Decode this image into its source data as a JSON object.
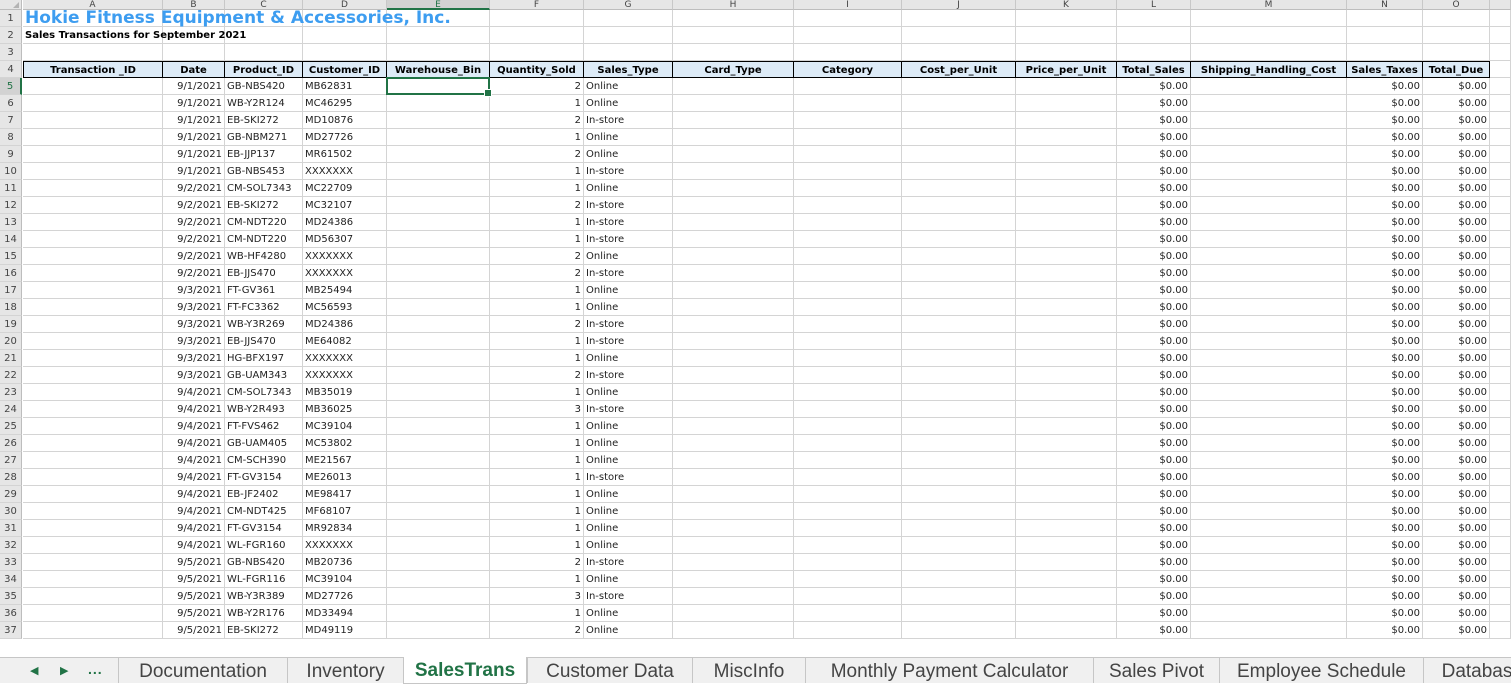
{
  "sheet": {
    "columns": [
      "A",
      "B",
      "C",
      "D",
      "E",
      "F",
      "G",
      "H",
      "I",
      "J",
      "K",
      "L",
      "M",
      "N",
      "O"
    ],
    "selected_column": "E",
    "selected_row": 5,
    "title": "Hokie Fitness Equipment & Accessories, Inc.",
    "subtitle": "Sales Transactions for September 2021",
    "headers": [
      "Transaction _ID",
      "Date",
      "Product_ID",
      "Customer_ID",
      "Warehouse_Bin",
      "Quantity_Sold",
      "Sales_Type",
      "Card_Type",
      "Category",
      "Cost_per_Unit",
      "Price_per_Unit",
      "Total_Sales",
      "Shipping_Handling_Cost",
      "Sales_Taxes",
      "Total_Due"
    ],
    "rows": [
      {
        "row": 5,
        "date": "9/1/2021",
        "product": "GB-NBS420",
        "customer": "MB62831",
        "qty": "2",
        "type": "Online",
        "total_sales": "$0.00",
        "taxes": "$0.00",
        "total_due": "$0.00"
      },
      {
        "row": 6,
        "date": "9/1/2021",
        "product": "WB-Y2R124",
        "customer": "MC46295",
        "qty": "1",
        "type": "Online",
        "total_sales": "$0.00",
        "taxes": "$0.00",
        "total_due": "$0.00"
      },
      {
        "row": 7,
        "date": "9/1/2021",
        "product": "EB-SKI272",
        "customer": "MD10876",
        "qty": "2",
        "type": "In-store",
        "total_sales": "$0.00",
        "taxes": "$0.00",
        "total_due": "$0.00"
      },
      {
        "row": 8,
        "date": "9/1/2021",
        "product": "GB-NBM271",
        "customer": "MD27726",
        "qty": "1",
        "type": "Online",
        "total_sales": "$0.00",
        "taxes": "$0.00",
        "total_due": "$0.00"
      },
      {
        "row": 9,
        "date": "9/1/2021",
        "product": "EB-JJP137",
        "customer": "MR61502",
        "qty": "2",
        "type": "Online",
        "total_sales": "$0.00",
        "taxes": "$0.00",
        "total_due": "$0.00"
      },
      {
        "row": 10,
        "date": "9/1/2021",
        "product": "GB-NBS453",
        "customer": "XXXXXXX",
        "qty": "1",
        "type": "In-store",
        "total_sales": "$0.00",
        "taxes": "$0.00",
        "total_due": "$0.00"
      },
      {
        "row": 11,
        "date": "9/2/2021",
        "product": "CM-SOL7343",
        "customer": "MC22709",
        "qty": "1",
        "type": "Online",
        "total_sales": "$0.00",
        "taxes": "$0.00",
        "total_due": "$0.00"
      },
      {
        "row": 12,
        "date": "9/2/2021",
        "product": "EB-SKI272",
        "customer": "MC32107",
        "qty": "2",
        "type": "In-store",
        "total_sales": "$0.00",
        "taxes": "$0.00",
        "total_due": "$0.00"
      },
      {
        "row": 13,
        "date": "9/2/2021",
        "product": "CM-NDT220",
        "customer": "MD24386",
        "qty": "1",
        "type": "In-store",
        "total_sales": "$0.00",
        "taxes": "$0.00",
        "total_due": "$0.00"
      },
      {
        "row": 14,
        "date": "9/2/2021",
        "product": "CM-NDT220",
        "customer": "MD56307",
        "qty": "1",
        "type": "In-store",
        "total_sales": "$0.00",
        "taxes": "$0.00",
        "total_due": "$0.00"
      },
      {
        "row": 15,
        "date": "9/2/2021",
        "product": "WB-HF4280",
        "customer": "XXXXXXX",
        "qty": "2",
        "type": "Online",
        "total_sales": "$0.00",
        "taxes": "$0.00",
        "total_due": "$0.00"
      },
      {
        "row": 16,
        "date": "9/2/2021",
        "product": "EB-JJS470",
        "customer": "XXXXXXX",
        "qty": "2",
        "type": "In-store",
        "total_sales": "$0.00",
        "taxes": "$0.00",
        "total_due": "$0.00"
      },
      {
        "row": 17,
        "date": "9/3/2021",
        "product": "FT-GV361",
        "customer": "MB25494",
        "qty": "1",
        "type": "Online",
        "total_sales": "$0.00",
        "taxes": "$0.00",
        "total_due": "$0.00"
      },
      {
        "row": 18,
        "date": "9/3/2021",
        "product": "FT-FC3362",
        "customer": "MC56593",
        "qty": "1",
        "type": "Online",
        "total_sales": "$0.00",
        "taxes": "$0.00",
        "total_due": "$0.00"
      },
      {
        "row": 19,
        "date": "9/3/2021",
        "product": "WB-Y3R269",
        "customer": "MD24386",
        "qty": "2",
        "type": "In-store",
        "total_sales": "$0.00",
        "taxes": "$0.00",
        "total_due": "$0.00"
      },
      {
        "row": 20,
        "date": "9/3/2021",
        "product": "EB-JJS470",
        "customer": "ME64082",
        "qty": "1",
        "type": "In-store",
        "total_sales": "$0.00",
        "taxes": "$0.00",
        "total_due": "$0.00"
      },
      {
        "row": 21,
        "date": "9/3/2021",
        "product": "HG-BFX197",
        "customer": "XXXXXXX",
        "qty": "1",
        "type": "Online",
        "total_sales": "$0.00",
        "taxes": "$0.00",
        "total_due": "$0.00"
      },
      {
        "row": 22,
        "date": "9/3/2021",
        "product": "GB-UAM343",
        "customer": "XXXXXXX",
        "qty": "2",
        "type": "In-store",
        "total_sales": "$0.00",
        "taxes": "$0.00",
        "total_due": "$0.00"
      },
      {
        "row": 23,
        "date": "9/4/2021",
        "product": "CM-SOL7343",
        "customer": "MB35019",
        "qty": "1",
        "type": "Online",
        "total_sales": "$0.00",
        "taxes": "$0.00",
        "total_due": "$0.00"
      },
      {
        "row": 24,
        "date": "9/4/2021",
        "product": "WB-Y2R493",
        "customer": "MB36025",
        "qty": "3",
        "type": "In-store",
        "total_sales": "$0.00",
        "taxes": "$0.00",
        "total_due": "$0.00"
      },
      {
        "row": 25,
        "date": "9/4/2021",
        "product": "FT-FVS462",
        "customer": "MC39104",
        "qty": "1",
        "type": "Online",
        "total_sales": "$0.00",
        "taxes": "$0.00",
        "total_due": "$0.00"
      },
      {
        "row": 26,
        "date": "9/4/2021",
        "product": "GB-UAM405",
        "customer": "MC53802",
        "qty": "1",
        "type": "Online",
        "total_sales": "$0.00",
        "taxes": "$0.00",
        "total_due": "$0.00"
      },
      {
        "row": 27,
        "date": "9/4/2021",
        "product": "CM-SCH390",
        "customer": "ME21567",
        "qty": "1",
        "type": "Online",
        "total_sales": "$0.00",
        "taxes": "$0.00",
        "total_due": "$0.00"
      },
      {
        "row": 28,
        "date": "9/4/2021",
        "product": "FT-GV3154",
        "customer": "ME26013",
        "qty": "1",
        "type": "In-store",
        "total_sales": "$0.00",
        "taxes": "$0.00",
        "total_due": "$0.00"
      },
      {
        "row": 29,
        "date": "9/4/2021",
        "product": "EB-JF2402",
        "customer": "ME98417",
        "qty": "1",
        "type": "Online",
        "total_sales": "$0.00",
        "taxes": "$0.00",
        "total_due": "$0.00"
      },
      {
        "row": 30,
        "date": "9/4/2021",
        "product": "CM-NDT425",
        "customer": "MF68107",
        "qty": "1",
        "type": "Online",
        "total_sales": "$0.00",
        "taxes": "$0.00",
        "total_due": "$0.00"
      },
      {
        "row": 31,
        "date": "9/4/2021",
        "product": "FT-GV3154",
        "customer": "MR92834",
        "qty": "1",
        "type": "Online",
        "total_sales": "$0.00",
        "taxes": "$0.00",
        "total_due": "$0.00"
      },
      {
        "row": 32,
        "date": "9/4/2021",
        "product": "WL-FGR160",
        "customer": "XXXXXXX",
        "qty": "1",
        "type": "Online",
        "total_sales": "$0.00",
        "taxes": "$0.00",
        "total_due": "$0.00"
      },
      {
        "row": 33,
        "date": "9/5/2021",
        "product": "GB-NBS420",
        "customer": "MB20736",
        "qty": "2",
        "type": "In-store",
        "total_sales": "$0.00",
        "taxes": "$0.00",
        "total_due": "$0.00"
      },
      {
        "row": 34,
        "date": "9/5/2021",
        "product": "WL-FGR116",
        "customer": "MC39104",
        "qty": "1",
        "type": "Online",
        "total_sales": "$0.00",
        "taxes": "$0.00",
        "total_due": "$0.00"
      },
      {
        "row": 35,
        "date": "9/5/2021",
        "product": "WB-Y3R389",
        "customer": "MD27726",
        "qty": "3",
        "type": "In-store",
        "total_sales": "$0.00",
        "taxes": "$0.00",
        "total_due": "$0.00"
      },
      {
        "row": 36,
        "date": "9/5/2021",
        "product": "WB-Y2R176",
        "customer": "MD33494",
        "qty": "1",
        "type": "Online",
        "total_sales": "$0.00",
        "taxes": "$0.00",
        "total_due": "$0.00"
      },
      {
        "row": 37,
        "date": "9/5/2021",
        "product": "EB-SKI272",
        "customer": "MD49119",
        "qty": "2",
        "type": "Online",
        "total_sales": "$0.00",
        "taxes": "$0.00",
        "total_due": "$0.00"
      }
    ]
  },
  "tabs": {
    "prev_icon": "◀",
    "next_icon": "▶",
    "more_label": "...",
    "items": [
      {
        "label": "Documentation",
        "active": false
      },
      {
        "label": "Inventory",
        "active": false
      },
      {
        "label": "SalesTrans",
        "active": true
      },
      {
        "label": "Customer Data",
        "active": false
      },
      {
        "label": "MiscInfo",
        "active": false
      },
      {
        "label": "Monthly Payment Calculator",
        "active": false
      },
      {
        "label": "Sales Pivot",
        "active": false
      },
      {
        "label": "Employee Schedule",
        "active": false
      },
      {
        "label": "Databas",
        "active": false
      }
    ]
  }
}
